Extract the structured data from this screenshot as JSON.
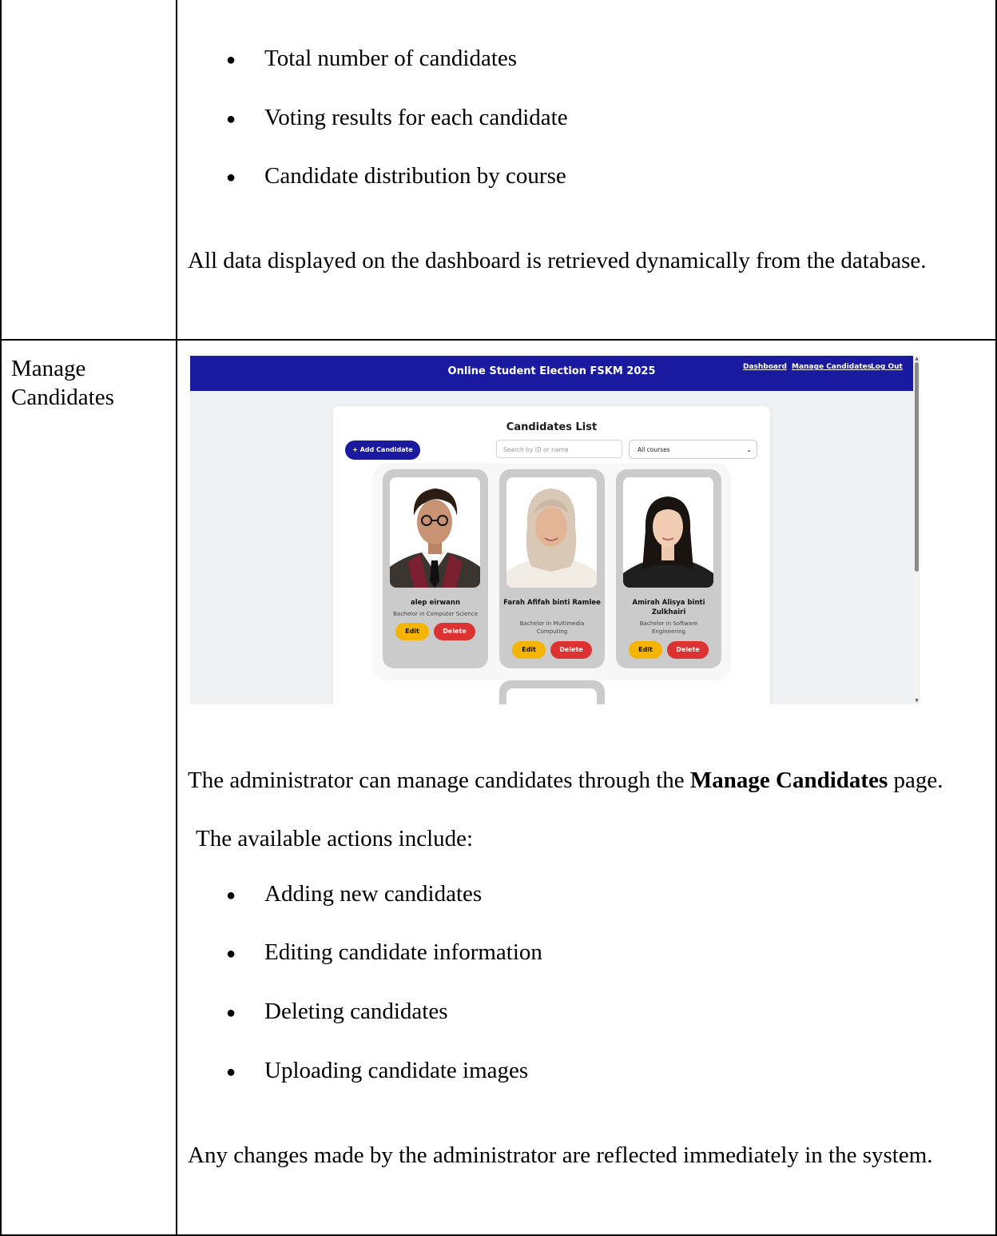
{
  "top_row": {
    "bullets": [
      "Total number of candidates",
      "Voting results for each candidate",
      "Candidate distribution by course"
    ],
    "bullet_symbol": "●",
    "note": "All data displayed on the dashboard is retrieved dynamically from the database."
  },
  "manage_row": {
    "label": "Manage Candidates",
    "screenshot": {
      "nav_title": "Online Student Election FSKM 2025",
      "nav_links": [
        "Dashboard",
        "Manage Candidates",
        "Log Out"
      ],
      "nav_color": "#1a1aa0",
      "panel_title": "Candidates List",
      "add_button": "+ Add Candidate",
      "search_placeholder": "Search by ID or name",
      "course_filter": "All courses",
      "cards": [
        {
          "name": "alep eirwann",
          "course": "Bachelor in Computer Science",
          "edit": "Edit",
          "delete": "Delete"
        },
        {
          "name": "Farah Afifah binti Ramlee",
          "course": "Bachelor in Multimedia Computing",
          "edit": "Edit",
          "delete": "Delete"
        },
        {
          "name": "Amirah Alisya binti Zulkhairi",
          "course": "Bachelor in Software Engineering",
          "edit": "Edit",
          "delete": "Delete"
        }
      ]
    },
    "intro_before": "The administrator can manage candidates through the ",
    "intro_bold": "Manage Candidates",
    "intro_after": " page.",
    "actions_intro": "The available actions include:",
    "actions": [
      "Adding new candidates",
      "Editing candidate information",
      "Deleting candidates",
      "Uploading candidate images"
    ],
    "closing": "Any changes made by the administrator are reflected immediately in the system."
  }
}
